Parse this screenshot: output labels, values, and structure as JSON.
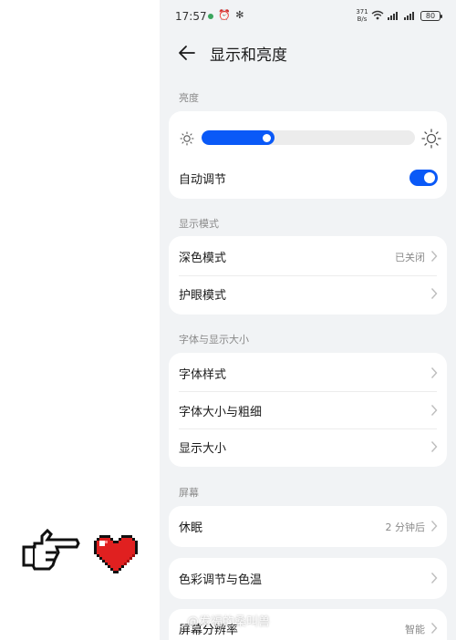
{
  "status_bar": {
    "time": "17:57",
    "left_icons": "⏰ ✻",
    "net_speed_value": "371",
    "net_speed_unit": "B/s",
    "battery": "80"
  },
  "header": {
    "title": "显示和亮度"
  },
  "brightness": {
    "section_label": "亮度",
    "level_fraction": 0.34,
    "auto_label": "自动调节",
    "auto_enabled": true
  },
  "display_mode": {
    "section_label": "显示模式",
    "dark_mode_label": "深色模式",
    "dark_mode_value": "已关闭",
    "eye_care_label": "护眼模式"
  },
  "font_display": {
    "section_label": "字体与显示大小",
    "font_style_label": "字体样式",
    "font_size_label": "字体大小与粗细",
    "display_size_label": "显示大小"
  },
  "screen": {
    "section_label": "屏幕",
    "sleep_label": "休眠",
    "sleep_value": "2 分钟后",
    "color_label": "色彩调节与色温",
    "resolution_label": "屏幕分辨率",
    "resolution_value": "智能"
  },
  "watermark": "@发福的桑叫兽",
  "colors": {
    "accent": "#0a59f7",
    "background": "#f1f3f5",
    "card": "#ffffff",
    "heart": "#e02020"
  }
}
